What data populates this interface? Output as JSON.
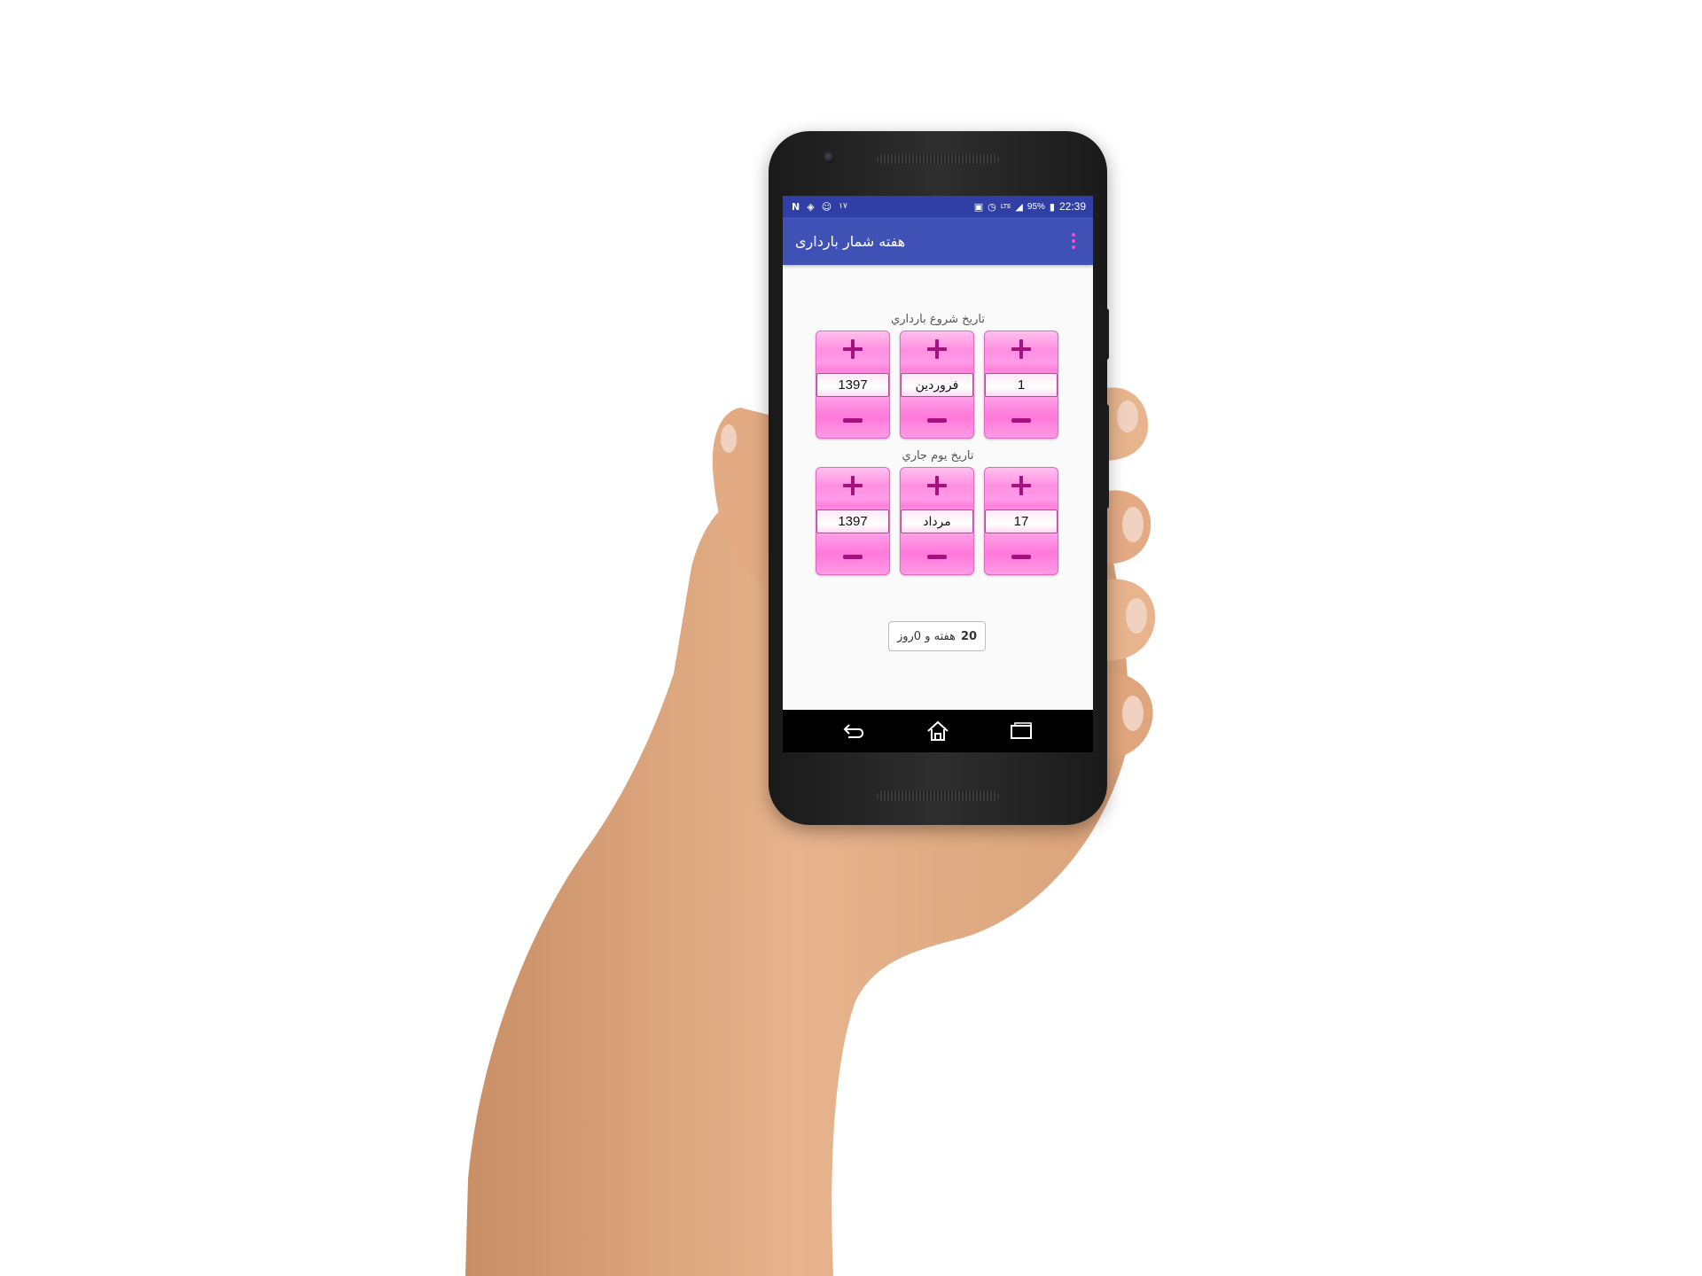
{
  "status_bar": {
    "time": "22:39",
    "battery": "95%",
    "network": "LTE",
    "left_icons": [
      "n-notification-icon",
      "shield-notification-icon",
      "face-notification-icon",
      "number-notification-icon"
    ],
    "right_icons": [
      "wifi-icon",
      "alarm-icon",
      "signal-icon",
      "battery-icon"
    ]
  },
  "app_bar": {
    "title": "هفته شمار بارداری",
    "menu_icon": "overflow-menu-icon",
    "accent_color": "#ff4ad6",
    "bar_color": "#3f51b5"
  },
  "start_date": {
    "label": "تاريخ شروع بارداري",
    "year": "1397",
    "month": "فروردين",
    "day": "1"
  },
  "current_date": {
    "label": "تاريخ يوم جاري",
    "year": "1397",
    "month": "مرداد",
    "day": "17"
  },
  "result": {
    "weeks": "20",
    "text": "هفته و 0روز"
  },
  "nav_bar": {
    "buttons": [
      "back-icon",
      "home-icon",
      "recents-icon"
    ]
  }
}
